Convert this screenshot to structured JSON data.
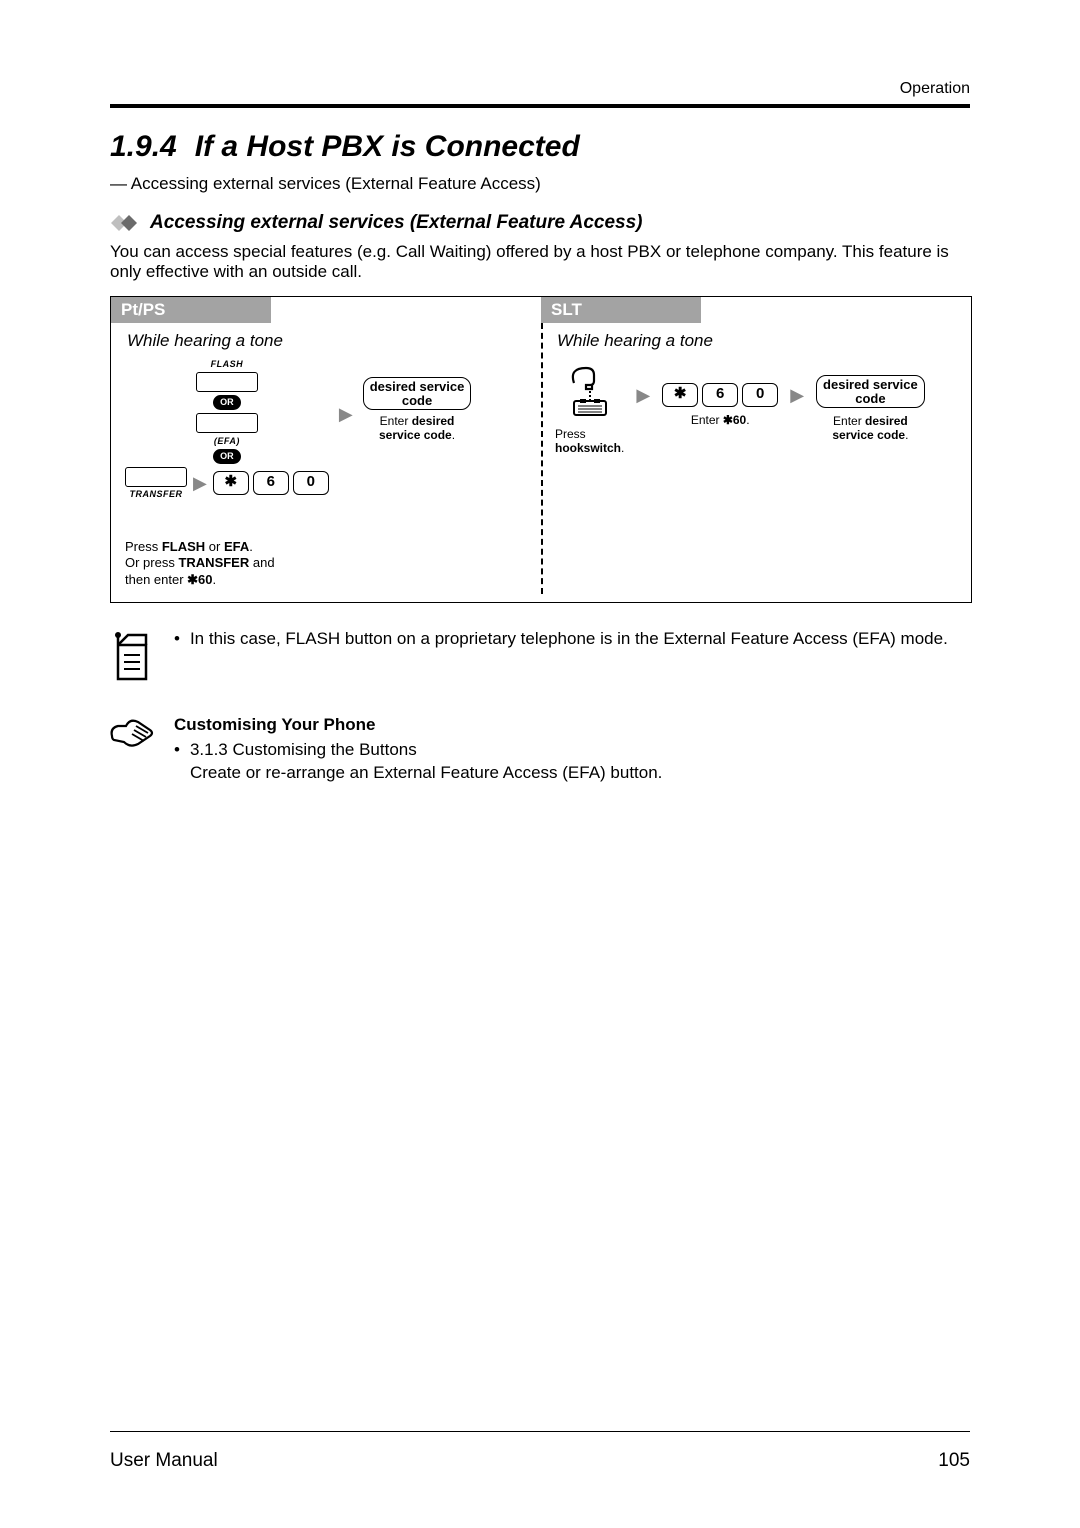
{
  "header": {
    "running": "Operation"
  },
  "section": {
    "number": "1.9.4",
    "title": "If a Host PBX is Connected",
    "intro": "— Accessing external services (External Feature Access)"
  },
  "sub": {
    "title": "Accessing external services (External Feature Access)",
    "body": "You can access special features (e.g. Call Waiting) offered by a host PBX or telephone company. This feature is only effective with an outside call."
  },
  "procedure": {
    "ptps": {
      "header": "Pt/PS",
      "condition": "While hearing a tone",
      "labels": {
        "flash": "FLASH",
        "efa": "(EFA)",
        "transfer": "TRANSFER",
        "or": "OR"
      },
      "digits": [
        "✱",
        "6",
        "0"
      ],
      "svc_box_l1": "desired service",
      "svc_box_l2": "code",
      "caption": "Enter desired service code.",
      "bottom_l1": "Press FLASH or EFA.",
      "bottom_l2": "Or press TRANSFER and",
      "bottom_l3": "then enter ✱60."
    },
    "slt": {
      "header": "SLT",
      "condition": "While hearing a tone",
      "hook_l1": "Press",
      "hook_l2": "hookswitch.",
      "digits": [
        "✱",
        "6",
        "0"
      ],
      "digits_caption": "Enter ✱60.",
      "svc_box_l1": "desired service",
      "svc_box_l2": "code",
      "caption": "Enter desired service code."
    }
  },
  "note": {
    "text": "In this case, FLASH button on a proprietary telephone is in the External Feature Access (EFA) mode."
  },
  "customise": {
    "heading": "Customising Your Phone",
    "ref": "3.1.3   Customising the Buttons",
    "desc": "Create or re-arrange an External Feature Access (EFA) button."
  },
  "footer": {
    "left": "User Manual",
    "page": "105"
  }
}
